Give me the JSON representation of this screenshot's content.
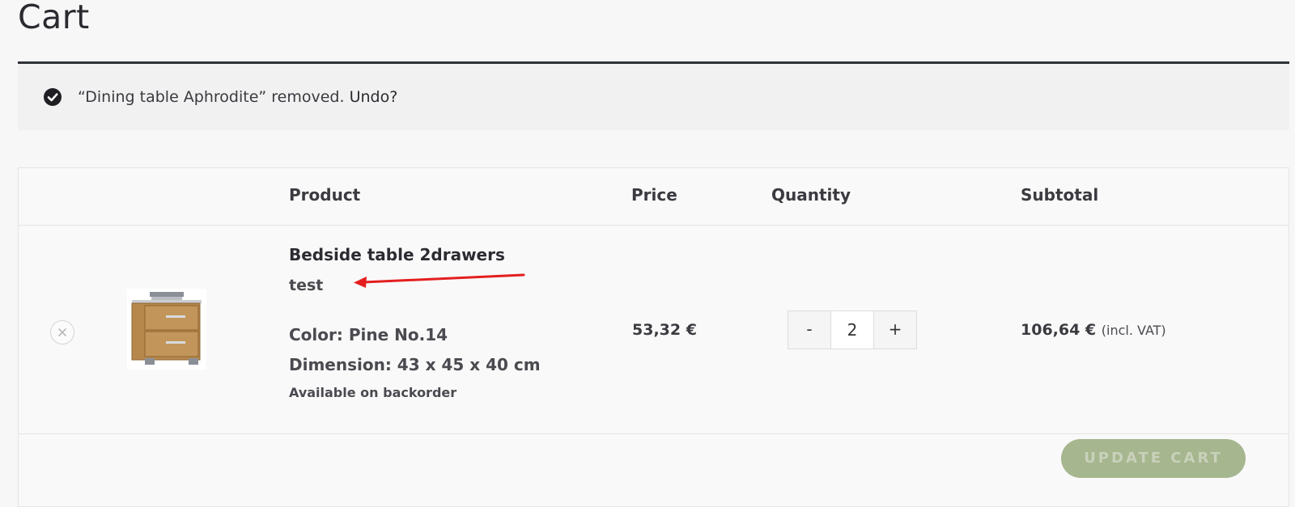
{
  "page": {
    "title": "Cart"
  },
  "notice": {
    "message": "“Dining table Aphrodite” removed.",
    "undo_label": "Undo?",
    "icon": "check-circle-icon"
  },
  "table": {
    "headers": {
      "product": "Product",
      "price": "Price",
      "quantity": "Quantity",
      "subtotal": "Subtotal"
    },
    "items": [
      {
        "name": "Bedside table 2drawers",
        "note": "test",
        "color": "Color: Pine No.14",
        "dimension": "Dimension: 43 x 45 x 40 cm",
        "availability": "Available on backorder",
        "price": "53,32 €",
        "quantity": "2",
        "subtotal": "106,64 €",
        "tax_note": "(incl. VAT)"
      }
    ]
  },
  "quantity_controls": {
    "minus_label": "-",
    "plus_label": "+"
  },
  "actions": {
    "update_cart_label": "UPDATE CART"
  },
  "colors": {
    "accent_button": "#a6b68e",
    "annotation_arrow": "#e41e1e",
    "text_primary": "#2b2b31"
  }
}
